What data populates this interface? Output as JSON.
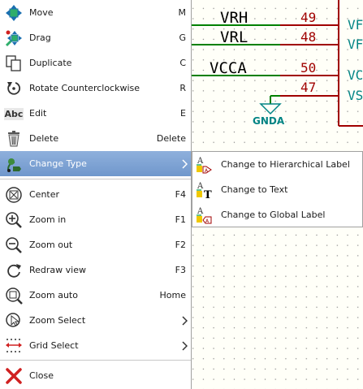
{
  "schematic": {
    "nets": [
      {
        "label": "VRH",
        "pin": "49",
        "pin_name": "VF"
      },
      {
        "label": "VRL",
        "pin": "48",
        "pin_name": "VF"
      },
      {
        "label": "VCCA",
        "pin": "50",
        "pin_name": "VC"
      },
      {
        "label": "",
        "pin": "47",
        "pin_name": "VS"
      }
    ],
    "power_symbol": "GNDA"
  },
  "menu": {
    "items": [
      {
        "label": "Move",
        "shortcut": "M",
        "icon": "move-icon"
      },
      {
        "label": "Drag",
        "shortcut": "G",
        "icon": "drag-icon"
      },
      {
        "label": "Duplicate",
        "shortcut": "C",
        "icon": "duplicate-icon"
      },
      {
        "label": "Rotate Counterclockwise",
        "shortcut": "R",
        "icon": "rotate-ccw-icon"
      },
      {
        "label": "Edit",
        "shortcut": "E",
        "icon": "edit-text-icon"
      },
      {
        "label": "Delete",
        "shortcut": "Delete",
        "icon": "trash-icon"
      },
      {
        "label": "Change Type",
        "shortcut": "",
        "icon": "change-type-icon",
        "submenu": true
      },
      {
        "label": "Center",
        "shortcut": "F4",
        "icon": "zoom-center-icon"
      },
      {
        "label": "Zoom in",
        "shortcut": "F1",
        "icon": "zoom-in-icon"
      },
      {
        "label": "Zoom out",
        "shortcut": "F2",
        "icon": "zoom-out-icon"
      },
      {
        "label": "Redraw view",
        "shortcut": "F3",
        "icon": "redraw-icon"
      },
      {
        "label": "Zoom auto",
        "shortcut": "Home",
        "icon": "zoom-fit-icon"
      },
      {
        "label": "Zoom Select",
        "shortcut": "",
        "icon": "zoom-select-icon",
        "submenu": true
      },
      {
        "label": "Grid Select",
        "shortcut": "",
        "icon": "grid-select-icon",
        "submenu": true
      },
      {
        "label": "Close",
        "shortcut": "",
        "icon": "close-icon"
      }
    ],
    "abc_icon_text": "Abc"
  },
  "submenu": {
    "items": [
      {
        "label": "Change to Hierarchical Label",
        "icon": "hierarchical-label-icon"
      },
      {
        "label": "Change to Text",
        "icon": "text-icon"
      },
      {
        "label": "Change to Global Label",
        "icon": "global-label-icon"
      }
    ],
    "glyph_a": "A",
    "glyph_t": "T"
  },
  "colors": {
    "selection": "#7aa0d2",
    "wire": "#008000",
    "pin": "#a00000",
    "pin_name": "#008484"
  }
}
